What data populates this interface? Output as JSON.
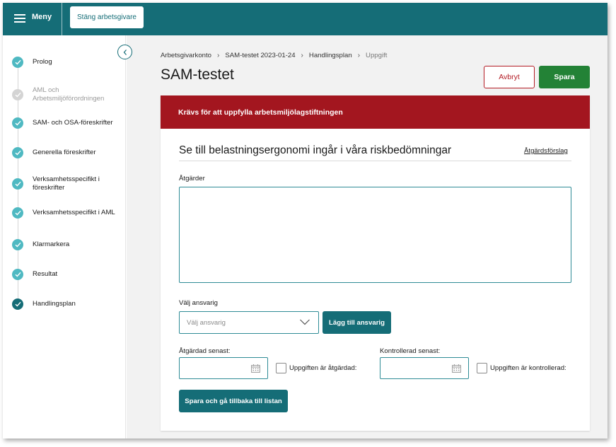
{
  "topbar": {
    "menu_label": "Meny",
    "close_employer_label": "Stäng arbetsgivare"
  },
  "sidebar": {
    "steps": [
      {
        "label": "Prolog",
        "state": "done"
      },
      {
        "label": "AML och Arbetsmiljöförordningen",
        "state": "inactive"
      },
      {
        "label": "SAM- och OSA-föreskrifter",
        "state": "done"
      },
      {
        "label": "Generella föreskrifter",
        "state": "done"
      },
      {
        "label": "Verksamhetsspecifikt i föreskrifter",
        "state": "done"
      },
      {
        "label": "Verksamhetsspecifikt i AML",
        "state": "done"
      },
      {
        "label": "Klarmarkera",
        "state": "done"
      },
      {
        "label": "Resultat",
        "state": "done"
      },
      {
        "label": "Handlingsplan",
        "state": "current"
      }
    ]
  },
  "breadcrumb": {
    "items": [
      "Arbetsgivarkonto",
      "SAM-testet 2023-01-24",
      "Handlingsplan"
    ],
    "current": "Uppgift"
  },
  "page": {
    "title": "SAM-testet",
    "cancel_label": "Avbryt",
    "save_label": "Spara"
  },
  "alert": {
    "text": "Krävs för att uppfylla arbetsmiljölagstiftningen"
  },
  "task": {
    "title": "Se till belastningsergonomi ingår i våra riskbedömningar",
    "link_label": "Åtgärdsförslag",
    "actions_label": "Åtgärder",
    "actions_value": "",
    "responsible_label": "Välj ansvarig",
    "responsible_placeholder": "Välj ansvarig",
    "add_responsible_label": "Lägg till ansvarig",
    "done_by_label": "Åtgärdad senast:",
    "done_by_value": "",
    "done_checkbox_label": "Uppgiften är åtgärdad:",
    "checked_by_label": "Kontrollerad senast:",
    "checked_by_value": "",
    "checked_checkbox_label": "Uppgiften är kontrollerad:",
    "save_back_label": "Spara och gå tillbaka till listan"
  },
  "colors": {
    "brand": "#156d77",
    "step_done": "#4fb9c2",
    "step_inactive": "#d4d4d4",
    "step_current": "#156d77",
    "alert": "#a3161f",
    "save": "#238236",
    "cancel": "#b31b24"
  },
  "icons": {
    "menu": "hamburger-icon",
    "collapse": "chevron-left-icon",
    "step_check": "check-icon",
    "select": "chevron-down-icon",
    "date": "calendar-icon"
  }
}
